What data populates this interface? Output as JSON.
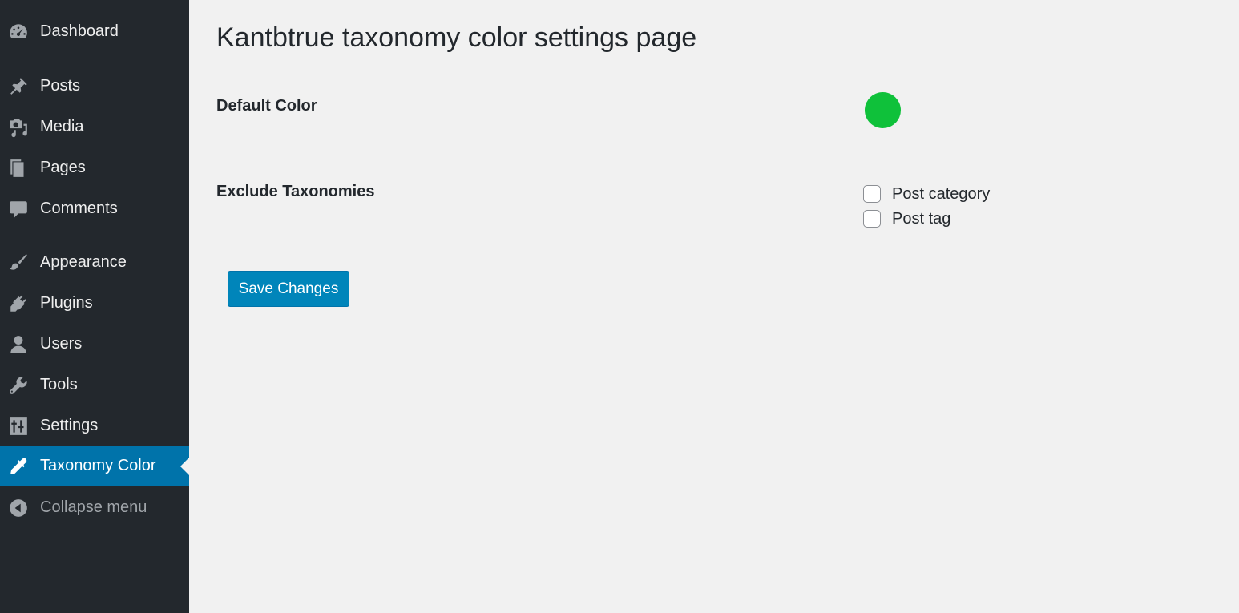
{
  "sidebar": {
    "items": [
      {
        "label": "Dashboard",
        "icon": "dashboard-icon"
      },
      {
        "label": "Posts",
        "icon": "pin-icon"
      },
      {
        "label": "Media",
        "icon": "media-icon"
      },
      {
        "label": "Pages",
        "icon": "pages-icon"
      },
      {
        "label": "Comments",
        "icon": "comment-icon"
      },
      {
        "label": "Appearance",
        "icon": "paintbrush-icon"
      },
      {
        "label": "Plugins",
        "icon": "plugin-icon"
      },
      {
        "label": "Users",
        "icon": "user-icon"
      },
      {
        "label": "Tools",
        "icon": "wrench-icon"
      },
      {
        "label": "Settings",
        "icon": "settings-icon"
      },
      {
        "label": "Taxonomy Color",
        "icon": "eyedropper-icon",
        "active": true
      },
      {
        "label": "Collapse menu",
        "icon": "collapse-arrow-icon"
      }
    ]
  },
  "page": {
    "title": "Kantbtrue taxonomy color settings page",
    "default_color_label": "Default Color",
    "default_color_value": "#0fc13a",
    "exclude_label": "Exclude Taxonomies",
    "taxonomies": [
      {
        "label": "Post category",
        "checked": false
      },
      {
        "label": "Post tag",
        "checked": false
      }
    ],
    "save_label": "Save Changes"
  },
  "colors": {
    "sidebar_bg": "#23282d",
    "active_bg": "#0073aa",
    "button_bg": "#0085ba",
    "content_bg": "#f1f1f1"
  }
}
